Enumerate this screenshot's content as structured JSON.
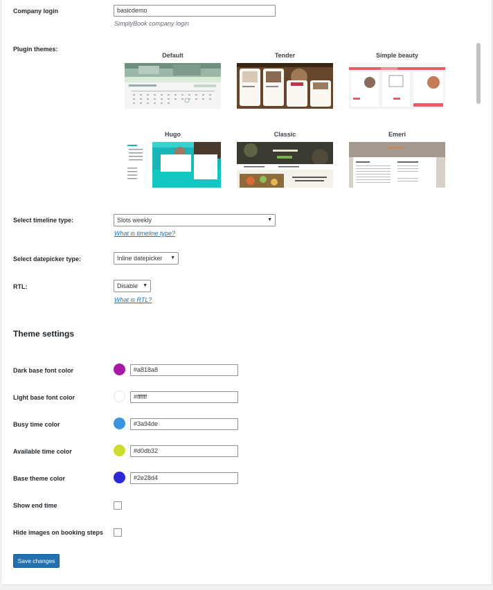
{
  "company_login": {
    "label": "Company login",
    "value": "basicdemo",
    "description": "SimplyBook company login"
  },
  "plugin_themes": {
    "label": "Plugin themes:",
    "themes": [
      {
        "name": "Default"
      },
      {
        "name": "Tender"
      },
      {
        "name": "Simple beauty"
      },
      {
        "name": "Hugo"
      },
      {
        "name": "Classic"
      },
      {
        "name": "Emeri"
      }
    ]
  },
  "timeline": {
    "label": "Select timeline type:",
    "value": "Slots weekly",
    "help_link": "What is timeline type?"
  },
  "datepicker": {
    "label": "Select datepicker type:",
    "value": "Inline datepicker"
  },
  "rtl": {
    "label": "RTL:",
    "value": "Disable",
    "help_link": "What is RTL?"
  },
  "theme_settings": {
    "heading": "Theme settings",
    "colors": [
      {
        "label": "Dark base font color",
        "value": "#a818a8",
        "swatch": "#a818a8"
      },
      {
        "label": "Light base font color",
        "value": "#ffffff",
        "swatch": "#ffffff"
      },
      {
        "label": "Busy time color",
        "value": "#3a94de",
        "swatch": "#3a94de"
      },
      {
        "label": "Available time color",
        "value": "#d0db32",
        "swatch": "#d0db32"
      },
      {
        "label": "Base theme color",
        "value": "#2e28d4",
        "swatch": "#2e28d4"
      }
    ],
    "show_end_time": {
      "label": "Show end time",
      "checked": false
    },
    "hide_images": {
      "label": "Hide images on booking steps",
      "checked": false
    }
  },
  "save_button": "Save changes"
}
